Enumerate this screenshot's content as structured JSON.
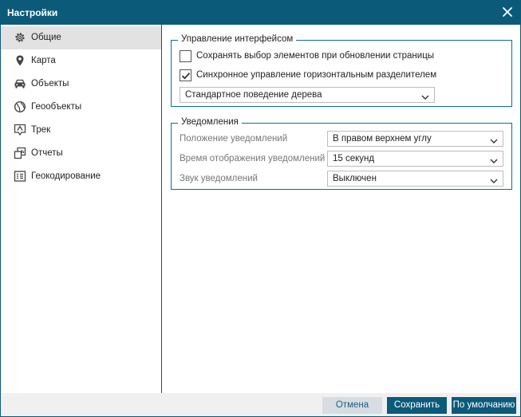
{
  "window": {
    "title": "Настройки",
    "close_icon": "close-icon"
  },
  "sidebar": {
    "items": [
      {
        "label": "Общие",
        "icon": "gear-icon",
        "active": true
      },
      {
        "label": "Карта",
        "icon": "map-pin-icon",
        "active": false
      },
      {
        "label": "Объекты",
        "icon": "car-icon",
        "active": false
      },
      {
        "label": "Геообъекты",
        "icon": "globe-icon",
        "active": false
      },
      {
        "label": "Трек",
        "icon": "track-icon",
        "active": false
      },
      {
        "label": "Отчеты",
        "icon": "reports-icon",
        "active": false
      },
      {
        "label": "Геокодирование",
        "icon": "geocoding-icon",
        "active": false
      }
    ]
  },
  "interface_group": {
    "legend": "Управление интерфейсом",
    "save_selection": {
      "label": "Сохранять выбор элементов при обновлении страницы",
      "checked": false
    },
    "sync_splitter": {
      "label": "Синхронное управление горизонтальным разделителем",
      "checked": true
    },
    "tree_behavior": {
      "value": "Стандартное поведение дерева"
    }
  },
  "notifications_group": {
    "legend": "Уведомления",
    "position": {
      "label": "Положение уведомлений",
      "value": "В правом верхнем углу"
    },
    "display_time": {
      "label": "Время отображения уведомлений",
      "value": "15 секунд"
    },
    "sound": {
      "label": "Звук уведомлений",
      "value": "Выключен"
    }
  },
  "footer": {
    "cancel_label": "Отмена",
    "save_label": "Сохранить",
    "default_label": "По умолчанию"
  },
  "colors": {
    "accent": "#0c5a7a",
    "active_item": "#e2e2e2",
    "cancel_bg": "#d7dde2"
  }
}
